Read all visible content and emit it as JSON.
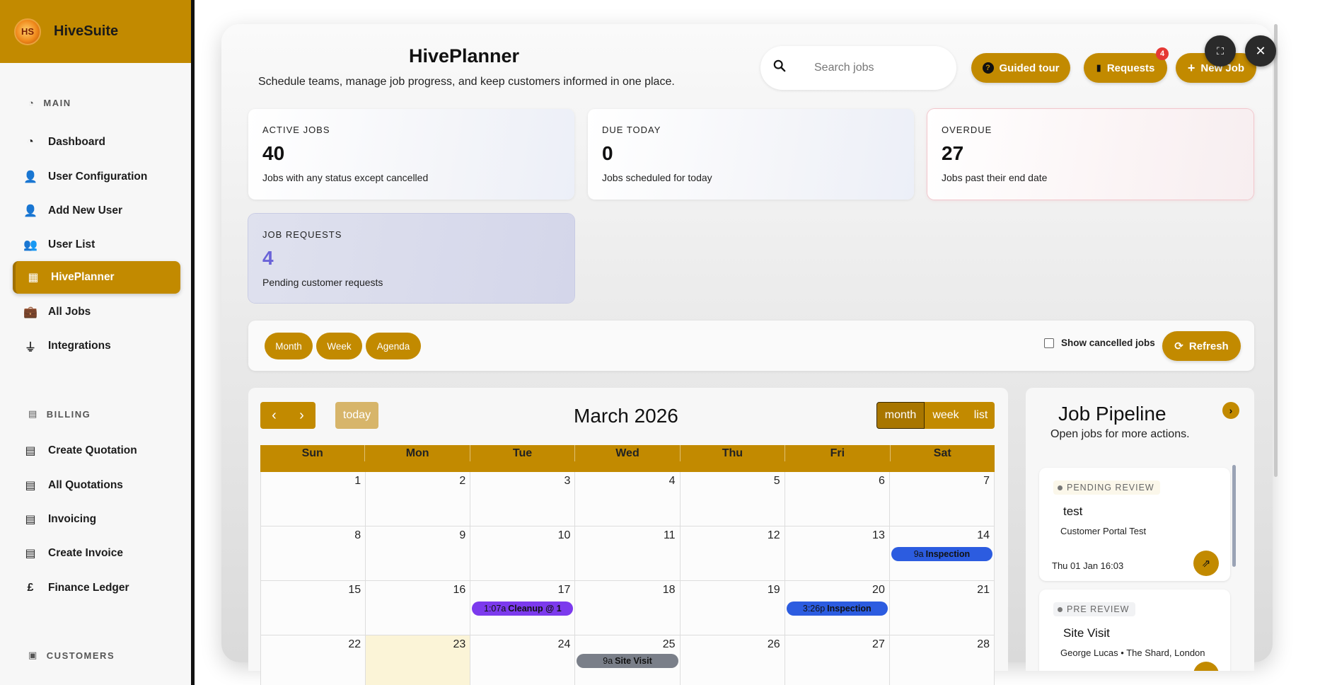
{
  "brand": {
    "name": "HiveSuite",
    "logo_text": "HS"
  },
  "sidebar": {
    "sections": [
      {
        "label": "MAIN",
        "icon": "gauge-icon"
      },
      {
        "label": "BILLING",
        "icon": "file-icon"
      },
      {
        "label": "CUSTOMERS",
        "icon": "contact-card-icon"
      }
    ],
    "items": [
      {
        "label": "Dashboard",
        "icon": "gauge-icon",
        "glyph": "◔"
      },
      {
        "label": "User Configuration",
        "icon": "user-icon",
        "glyph": "👤"
      },
      {
        "label": "Add New User",
        "icon": "user-plus-icon",
        "glyph": "👤"
      },
      {
        "label": "User List",
        "icon": "users-icon",
        "glyph": "👥"
      },
      {
        "label": "HivePlanner",
        "icon": "calendar-icon",
        "glyph": "▦"
      },
      {
        "label": "All Jobs",
        "icon": "briefcase-icon",
        "glyph": "💼"
      },
      {
        "label": "Integrations",
        "icon": "plug-icon",
        "glyph": "⏚"
      },
      {
        "label": "Create Quotation",
        "icon": "file-invoice-icon",
        "glyph": "▤"
      },
      {
        "label": "All Quotations",
        "icon": "file-invoice-icon",
        "glyph": "▤"
      },
      {
        "label": "Invoicing",
        "icon": "file-invoice-icon",
        "glyph": "▤"
      },
      {
        "label": "Create Invoice",
        "icon": "file-invoice-icon",
        "glyph": "▤"
      },
      {
        "label": "Finance Ledger",
        "icon": "pound-icon",
        "glyph": "£"
      }
    ],
    "active_index": 4
  },
  "header": {
    "title": "HivePlanner",
    "subtitle": "Schedule teams, manage job progress, and keep customers informed in one place.",
    "search_placeholder": "Search jobs",
    "guided_tour": "Guided tour",
    "requests": "Requests",
    "requests_badge": "4",
    "new_job": "New Job"
  },
  "stats": {
    "active": {
      "label": "ACTIVE JOBS",
      "value": "40",
      "desc": "Jobs with any status except cancelled"
    },
    "due": {
      "label": "DUE TODAY",
      "value": "0",
      "desc": "Jobs scheduled for today"
    },
    "overdue": {
      "label": "OVERDUE",
      "value": "27",
      "desc": "Jobs past their end date"
    },
    "requests": {
      "label": "JOB REQUESTS",
      "value": "4",
      "desc": "Pending customer requests"
    }
  },
  "toolbar": {
    "views": [
      "Month",
      "Week",
      "Agenda"
    ],
    "show_cancelled": "Show cancelled jobs",
    "show_cancelled_checked": false,
    "refresh": "Refresh"
  },
  "calendar": {
    "title": "March 2026",
    "today_label": "today",
    "view_buttons": [
      "month",
      "week",
      "list"
    ],
    "active_view": "month",
    "days_of_week": [
      "Sun",
      "Mon",
      "Tue",
      "Wed",
      "Thu",
      "Fri",
      "Sat"
    ],
    "weeks": [
      [
        "1",
        "2",
        "3",
        "4",
        "5",
        "6",
        "7"
      ],
      [
        "8",
        "9",
        "10",
        "11",
        "12",
        "13",
        "14"
      ],
      [
        "15",
        "16",
        "17",
        "18",
        "19",
        "20",
        "21"
      ],
      [
        "22",
        "23",
        "24",
        "25",
        "26",
        "27",
        "28"
      ]
    ],
    "today": "23",
    "events": [
      {
        "day": "14",
        "time": "9a",
        "title": "Inspection",
        "color": "#2c5ce0"
      },
      {
        "day": "17",
        "time": "1:07a",
        "title": "Cleanup @ 1",
        "color": "#7c3aed"
      },
      {
        "day": "20",
        "time": "3:26p",
        "title": "Inspection",
        "color": "#2c5ce0"
      },
      {
        "day": "25",
        "time": "9a",
        "title": "Site Visit",
        "color": "#7a7f89"
      }
    ]
  },
  "pipeline": {
    "title": "Job Pipeline",
    "subtitle": "Open jobs for more actions.",
    "jobs": [
      {
        "status": "PENDING REVIEW",
        "name": "test",
        "customer": "Customer Portal Test",
        "date": "Thu 01 Jan 16:03"
      },
      {
        "status": "PRE REVIEW",
        "name": "Site Visit",
        "customer": "George Lucas • The Shard, London",
        "date": ""
      }
    ]
  },
  "colors": {
    "accent": "#c28a00",
    "sidebar_bg": "#f7f7f7",
    "request_num": "#6a63d8",
    "badge": "#e53935"
  }
}
